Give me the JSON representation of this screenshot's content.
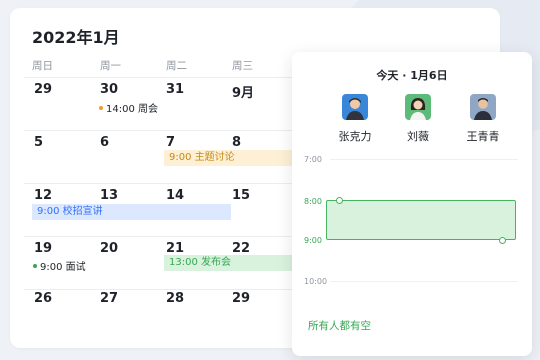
{
  "calendar": {
    "title": "2022年1月",
    "weekdays": [
      "周日",
      "周一",
      "周二",
      "周三"
    ],
    "rows": [
      [
        "29",
        "30",
        "31",
        "9月"
      ],
      [
        "5",
        "6",
        "7",
        "8"
      ],
      [
        "12",
        "13",
        "14",
        "15"
      ],
      [
        "19",
        "20",
        "21",
        "22"
      ],
      [
        "26",
        "27",
        "28",
        "29"
      ]
    ],
    "events": {
      "weekly_meeting": "14:00 周会",
      "topic_discussion": "9:00 主题讨论",
      "campus_talk": "9:00 校招宣讲",
      "interview": "9:00 面试",
      "release": "13:00 发布会"
    }
  },
  "panel": {
    "title": "今天 · 1月6日",
    "members": [
      "张克力",
      "刘薇",
      "王青青"
    ],
    "times": [
      "7:00",
      "8:00",
      "9:00",
      "10:00"
    ],
    "footer": "所有人都有空"
  },
  "colors": {
    "accent_green": "#34a853",
    "orange_event_bg": "#fdf0d5",
    "orange_event_text": "#c38a1a",
    "blue_event_bg": "#dbe8fd",
    "blue_event_text": "#3370ff",
    "green_event_bg": "#d9f2dd",
    "green_event_text": "#34a853"
  },
  "icons": [
    "avatar-zhang",
    "avatar-liu",
    "avatar-wang"
  ]
}
